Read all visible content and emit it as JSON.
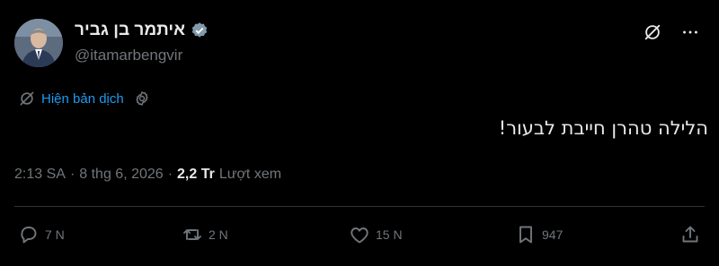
{
  "author": {
    "display_name": "איתמר בן גביר",
    "handle": "@itamarbengvir"
  },
  "translate": {
    "label": "Hiện bản dịch"
  },
  "tweet": {
    "text": "הלילה טהרן חייבת לבעור!"
  },
  "meta": {
    "time": "2:13 SA",
    "sep1": "·",
    "date": "8 thg 6, 2026",
    "sep2": "·",
    "views_count": "2,2 Tr",
    "views_label": "Lượt xem"
  },
  "actions": {
    "replies": "7 N",
    "reposts": "2 N",
    "likes": "15 N",
    "bookmarks": "947"
  },
  "colors": {
    "background": "#000000",
    "text": "#e7e9ea",
    "muted": "#71767b",
    "link": "#1d9bf0",
    "divider": "#2f3336"
  }
}
